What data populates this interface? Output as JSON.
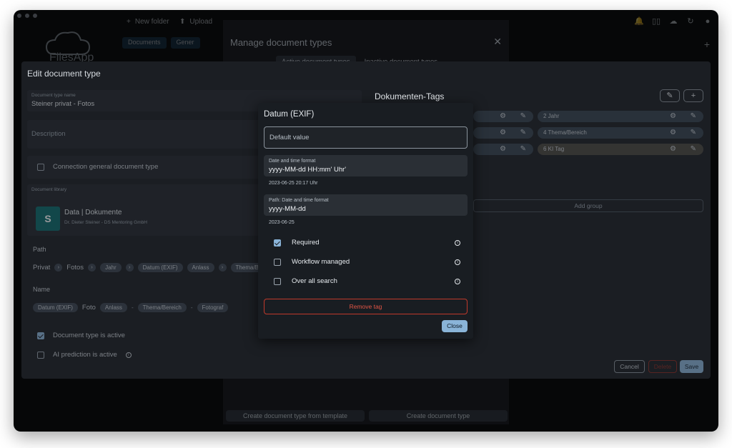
{
  "app": {
    "name": "FilesApp"
  },
  "toolbar": {
    "new_folder": "New folder",
    "upload": "Upload"
  },
  "tabs": [
    "Documents",
    "Gener"
  ],
  "manage_dialog": {
    "title": "Manage document types",
    "tab_active": "Active document types",
    "tab_inactive": "Inactive document types",
    "btn_template": "Create document type from template",
    "btn_create": "Create document type"
  },
  "edit": {
    "title": "Edit document type",
    "name_label": "Document type name",
    "name_value": "Steiner privat - Fotos",
    "description_placeholder": "Description",
    "connection_label": "Connection general document type",
    "library_label": "Document library",
    "library_name": "Data | Dokumente",
    "library_owner": "Dr. Dieter Steiner - DS Mentoring GmbH",
    "path_label": "Path",
    "path": {
      "privat": "Privat",
      "fotos": "Fotos",
      "jahr": "Jahr",
      "datum": "Datum (EXIF)",
      "anlass": "Anlass",
      "thema": "Thema/B"
    },
    "name_section_label": "Name",
    "name_parts": {
      "datum": "Datum (EXIF)",
      "foto": "Foto",
      "anlass": "Anlass",
      "dash": "-",
      "thema": "Thema/Bereich",
      "fotograf": "Fotograf"
    },
    "active_label": "Document type is active",
    "ai_label": "AI prediction is active",
    "tags_title": "Dokumenten-Tags",
    "tags": {
      "t2": "2  Jahr",
      "t4": "4  Thema/Bereich",
      "t6": "6  KI Tag"
    },
    "add_group": "Add group",
    "cancel": "Cancel",
    "delete": "Delete",
    "save": "Save"
  },
  "modal": {
    "title": "Datum (EXIF)",
    "default_placeholder": "Default value",
    "format_label": "Date and time format",
    "format_value": "yyyy-MM-dd HH:mm' Uhr'",
    "format_sample": "2023-06-25 20:17 Uhr",
    "path_format_label": "Path: Date and time format",
    "path_format_value": "yyyy-MM-dd",
    "path_format_sample": "2023-06-25",
    "required_label": "Required",
    "workflow_label": "Workflow managed",
    "search_label": "Over all search",
    "required_checked": true,
    "remove_tag": "Remove tag",
    "close": "Close"
  }
}
